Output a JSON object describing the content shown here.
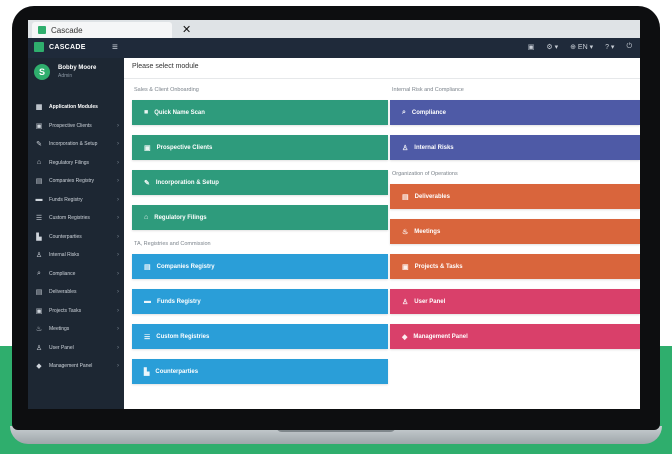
{
  "browser": {
    "tab_title": "Cascade",
    "close_glyph": "✕"
  },
  "app": {
    "brand": "CASCADE",
    "menu_glyph": "≡",
    "top_right": [
      "▣",
      "⚙ ▾",
      "⊕ EN ▾",
      "? ▾",
      "⏻"
    ]
  },
  "user": {
    "initials": "S",
    "name": "Bobby Moore",
    "role": "Admin"
  },
  "sidebar": {
    "items": [
      {
        "icon": "▦",
        "label": "Application Modules",
        "caret": ""
      },
      {
        "icon": "▣",
        "label": "Prospective Clients",
        "caret": "›"
      },
      {
        "icon": "✎",
        "label": "Incorporation & Setup",
        "caret": "›"
      },
      {
        "icon": "⌂",
        "label": "Regulatory Filings",
        "caret": "›"
      },
      {
        "icon": "▤",
        "label": "Companies Registry",
        "caret": "›"
      },
      {
        "icon": "▬",
        "label": "Funds Registry",
        "caret": "›"
      },
      {
        "icon": "☰",
        "label": "Custom Registries",
        "caret": "›"
      },
      {
        "icon": "▙",
        "label": "Counterparties",
        "caret": "›"
      },
      {
        "icon": "♙",
        "label": "Internal Risks",
        "caret": "›"
      },
      {
        "icon": "⌕",
        "label": "Compliance",
        "caret": "›"
      },
      {
        "icon": "▤",
        "label": "Deliverables",
        "caret": "›"
      },
      {
        "icon": "▣",
        "label": "Projects Tasks",
        "caret": "›"
      },
      {
        "icon": "♨",
        "label": "Meetings",
        "caret": "›"
      },
      {
        "icon": "♙",
        "label": "User Panel",
        "caret": "›"
      },
      {
        "icon": "◆",
        "label": "Management Panel",
        "caret": "›"
      }
    ]
  },
  "main": {
    "title": "Please select module",
    "left": {
      "section1": "Sales & Client Onboarding",
      "section1_modules": [
        {
          "icon": "■",
          "label": "Quick Name Scan"
        },
        {
          "icon": "▣",
          "label": "Prospective Clients"
        },
        {
          "icon": "✎",
          "label": "Incorporation & Setup"
        },
        {
          "icon": "⌂",
          "label": "Regulatory Filings"
        }
      ],
      "section2": "TA, Registries and Commission",
      "section2_modules": [
        {
          "icon": "▤",
          "label": "Companies Registry"
        },
        {
          "icon": "▬",
          "label": "Funds Registry"
        },
        {
          "icon": "☰",
          "label": "Custom Registries"
        },
        {
          "icon": "▙",
          "label": "Counterparties"
        }
      ]
    },
    "right": {
      "section1": "Internal Risk and Compliance",
      "section1_modules": [
        {
          "icon": "⌕",
          "label": "Compliance"
        },
        {
          "icon": "♙",
          "label": "Internal Risks"
        }
      ],
      "section2": "Organization of Operations",
      "section2_modules": [
        {
          "icon": "▤",
          "label": "Deliverables"
        },
        {
          "icon": "♨",
          "label": "Meetings"
        },
        {
          "icon": "▣",
          "label": "Projects & Tasks"
        },
        {
          "icon": "♙",
          "label": "User Panel"
        },
        {
          "icon": "◆",
          "label": "Management Panel"
        }
      ]
    }
  },
  "colors": {
    "green": "#2e9b7c",
    "blue": "#2a9ed8",
    "indigo": "#4e5aa6",
    "orange": "#d9653c",
    "pink": "#d9406a",
    "sidebar": "#1d2733",
    "background_band": "#2fae6d"
  }
}
